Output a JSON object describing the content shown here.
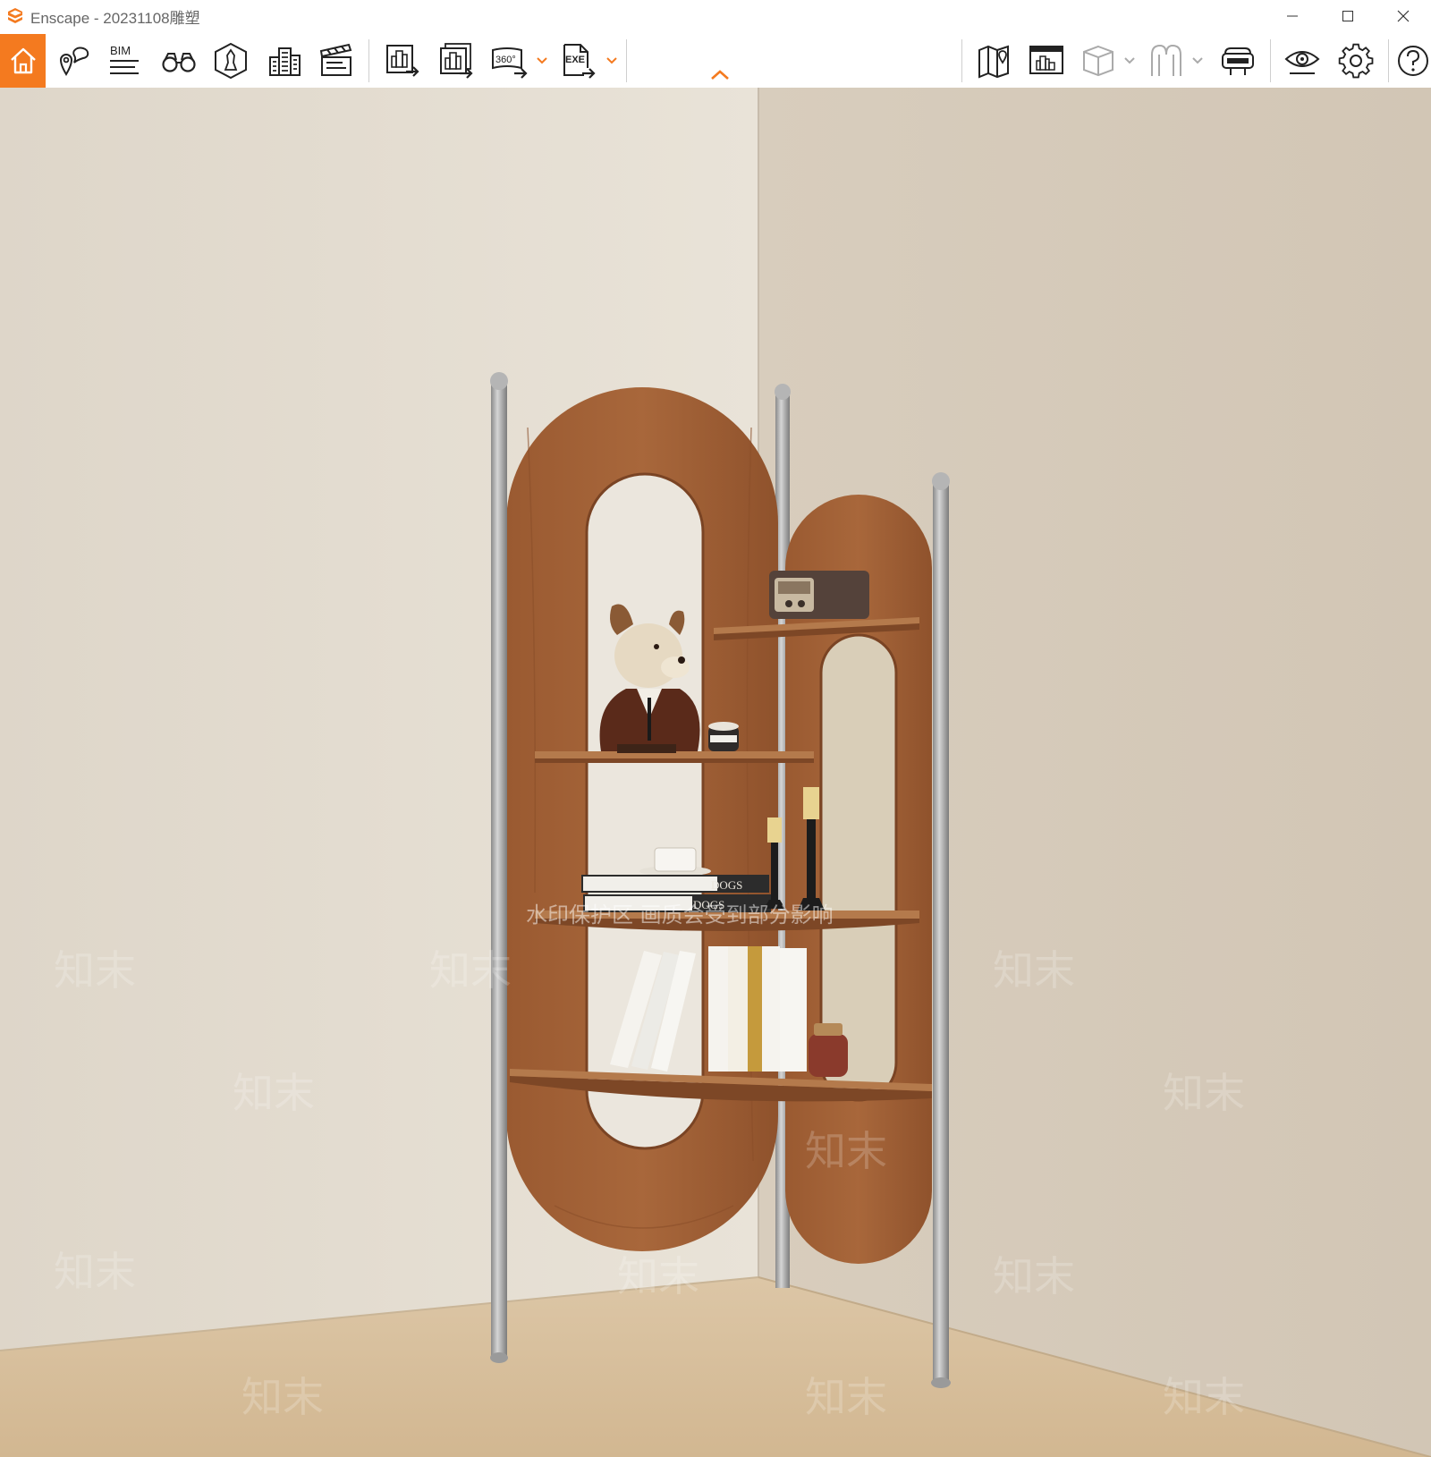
{
  "window": {
    "title": "Enscape - 20231108雕塑",
    "controls": [
      "minimize-icon",
      "maximize-icon",
      "close-icon"
    ]
  },
  "toolbar": {
    "accent_color": "#f47a1f",
    "left_group": [
      {
        "name": "home-icon",
        "active": true
      },
      {
        "name": "views-icon"
      },
      {
        "name": "bim-icon",
        "label": "BIM"
      },
      {
        "name": "binoculars-icon"
      },
      {
        "name": "asset-library-icon"
      },
      {
        "name": "buildings-icon"
      },
      {
        "name": "video-editor-icon"
      }
    ],
    "export_group": [
      {
        "name": "batch-render-icon"
      },
      {
        "name": "batch-render-all-icon"
      },
      {
        "name": "panorama-icon",
        "label": "360°",
        "has_dropdown": true
      },
      {
        "name": "exe-export-icon",
        "label": "EXE",
        "has_dropdown": true
      }
    ],
    "collapse_icon": "chevron-up-icon",
    "right_group": [
      {
        "name": "map-icon"
      },
      {
        "name": "presentation-icon"
      },
      {
        "name": "cube-icon",
        "has_dropdown": true
      },
      {
        "name": "material-icon",
        "has_dropdown": true
      },
      {
        "name": "vr-headset-icon"
      },
      {
        "name": "visual-settings-icon"
      },
      {
        "name": "settings-gear-icon"
      },
      {
        "name": "help-icon"
      }
    ]
  },
  "viewport": {
    "book_spine_text": "DOGS",
    "watermark_banner": "水印保护区 画质会受到部分影响",
    "watermark_text": "知末",
    "colors": {
      "wall_left": "#e3dcd0",
      "wall_right": "#d6cab9",
      "floor": "#d7bf9e",
      "wood": "#9c5f36",
      "metal": "#a6a6a6"
    }
  }
}
